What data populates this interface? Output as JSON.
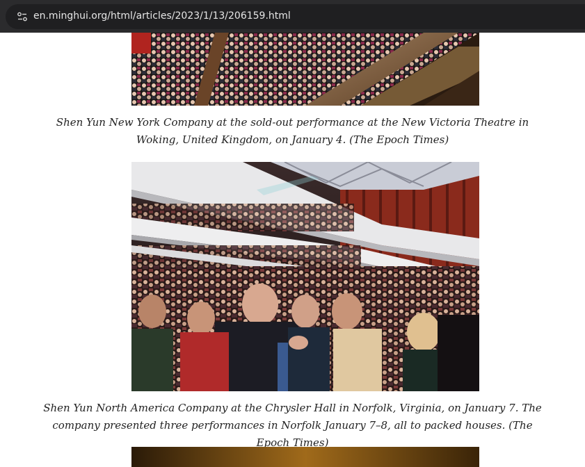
{
  "browser": {
    "url": "en.minghui.org/html/articles/2023/1/13/206159.html",
    "site_icon": "site-settings-icon"
  },
  "article": {
    "images": [
      {
        "alt_subject": "theatre-audience-orchestra-pit-photo",
        "caption_main": "Shen Yun New York Company at the sold-out performance at the New Victoria Theatre in Woking, United Kingdom, on January 4.",
        "caption_credit": "(The Epoch Times)"
      },
      {
        "alt_subject": "concert-hall-applauding-audience-photo",
        "caption_main": "Shen Yun North America Company at the Chrysler Hall in Norfolk, Virginia, on January 7. The company presented three performances in Norfolk January 7–8, all to packed houses.",
        "caption_credit": "(The Epoch Times)"
      },
      {
        "alt_subject": "stage-photo-partially-visible"
      }
    ]
  },
  "colors": {
    "browser_bar": "#2b2b2d",
    "url_pill": "#1f1f21",
    "caption_text": "#222222"
  }
}
